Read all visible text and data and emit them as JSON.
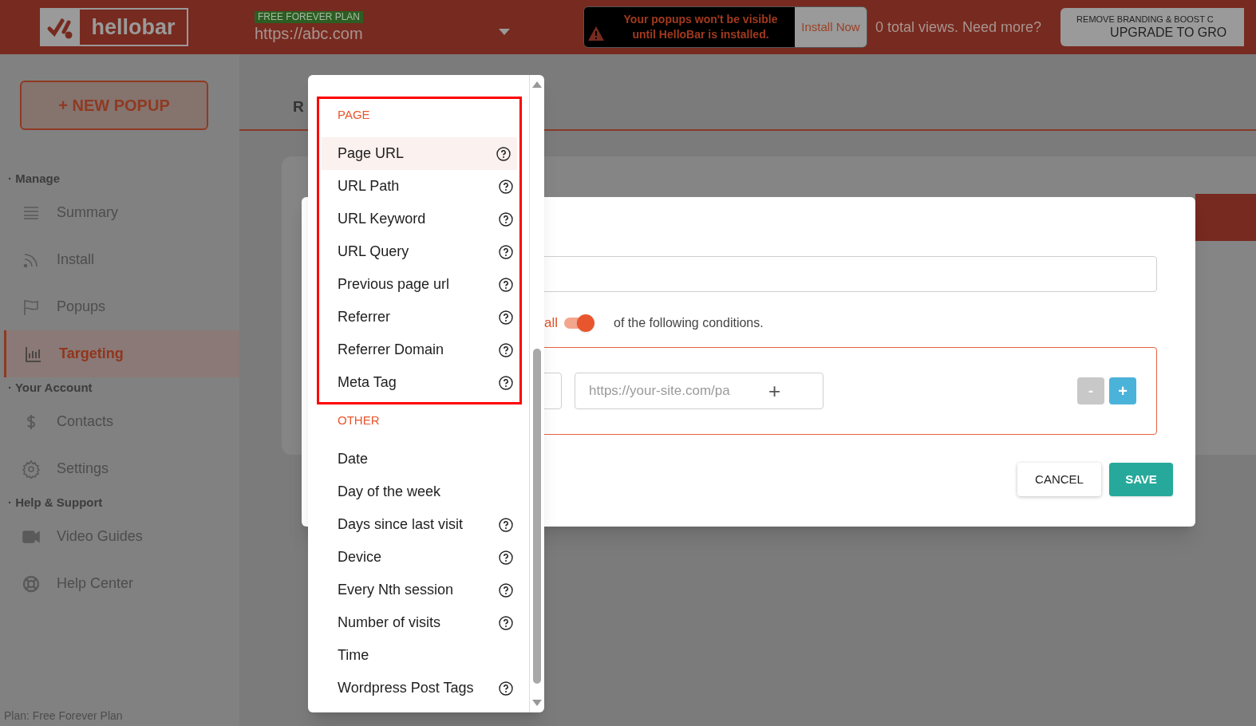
{
  "header": {
    "logo": "hellobar",
    "plan_badge": "FREE FOREVER PLAN",
    "site_url": "https://abc.com",
    "alert": {
      "message": "Your popups won't be visible until HelloBar is installed.",
      "button": "Install Now"
    },
    "views_text": "0 total views. Need more?",
    "upgrade": {
      "line1": "REMOVE BRANDING & BOOST C",
      "line2": "UPGRADE TO GRO"
    }
  },
  "sidebar": {
    "new_button": "+ NEW POPUP",
    "sections": [
      {
        "title": "· Manage",
        "items": [
          {
            "label": "Summary",
            "selected": false
          },
          {
            "label": "Install",
            "selected": false
          },
          {
            "label": "Popups",
            "selected": false
          },
          {
            "label": "Targeting",
            "selected": true
          }
        ]
      },
      {
        "title": "· Your Account",
        "items": [
          {
            "label": "Contacts",
            "selected": false
          },
          {
            "label": "Settings",
            "selected": false
          }
        ]
      },
      {
        "title": "· Help & Support",
        "items": [
          {
            "label": "Video Guides",
            "selected": false
          },
          {
            "label": "Help Center",
            "selected": false
          }
        ]
      }
    ],
    "plan_text": "Plan: Free Forever Plan"
  },
  "background": {
    "tab_label": "R"
  },
  "modal": {
    "match_word": "all",
    "toggle_on": true,
    "conditions_text": "of the following conditions.",
    "url_placeholder": "https://your-site.com/pa",
    "add_value": "+",
    "remove_button": "-",
    "add_button": "+",
    "cancel": "CANCEL",
    "save": "SAVE"
  },
  "dropdown": {
    "groups": [
      {
        "title": "PAGE",
        "highlighted": true,
        "items": [
          {
            "label": "Page URL",
            "help": true,
            "selected": true
          },
          {
            "label": "URL Path",
            "help": true,
            "selected": false
          },
          {
            "label": "URL Keyword",
            "help": true,
            "selected": false
          },
          {
            "label": "URL Query",
            "help": true,
            "selected": false
          },
          {
            "label": "Previous page url",
            "help": true,
            "selected": false
          },
          {
            "label": "Referrer",
            "help": true,
            "selected": false
          },
          {
            "label": "Referrer Domain",
            "help": true,
            "selected": false
          },
          {
            "label": "Meta Tag",
            "help": true,
            "selected": false
          }
        ]
      },
      {
        "title": "OTHER",
        "highlighted": false,
        "items": [
          {
            "label": "Date",
            "help": false,
            "selected": false
          },
          {
            "label": "Day of the week",
            "help": false,
            "selected": false
          },
          {
            "label": "Days since last visit",
            "help": true,
            "selected": false
          },
          {
            "label": "Device",
            "help": true,
            "selected": false
          },
          {
            "label": "Every Nth session",
            "help": true,
            "selected": false
          },
          {
            "label": "Number of visits",
            "help": true,
            "selected": false
          },
          {
            "label": "Time",
            "help": false,
            "selected": false
          },
          {
            "label": "Wordpress Post Tags",
            "help": true,
            "selected": false
          }
        ]
      }
    ]
  }
}
